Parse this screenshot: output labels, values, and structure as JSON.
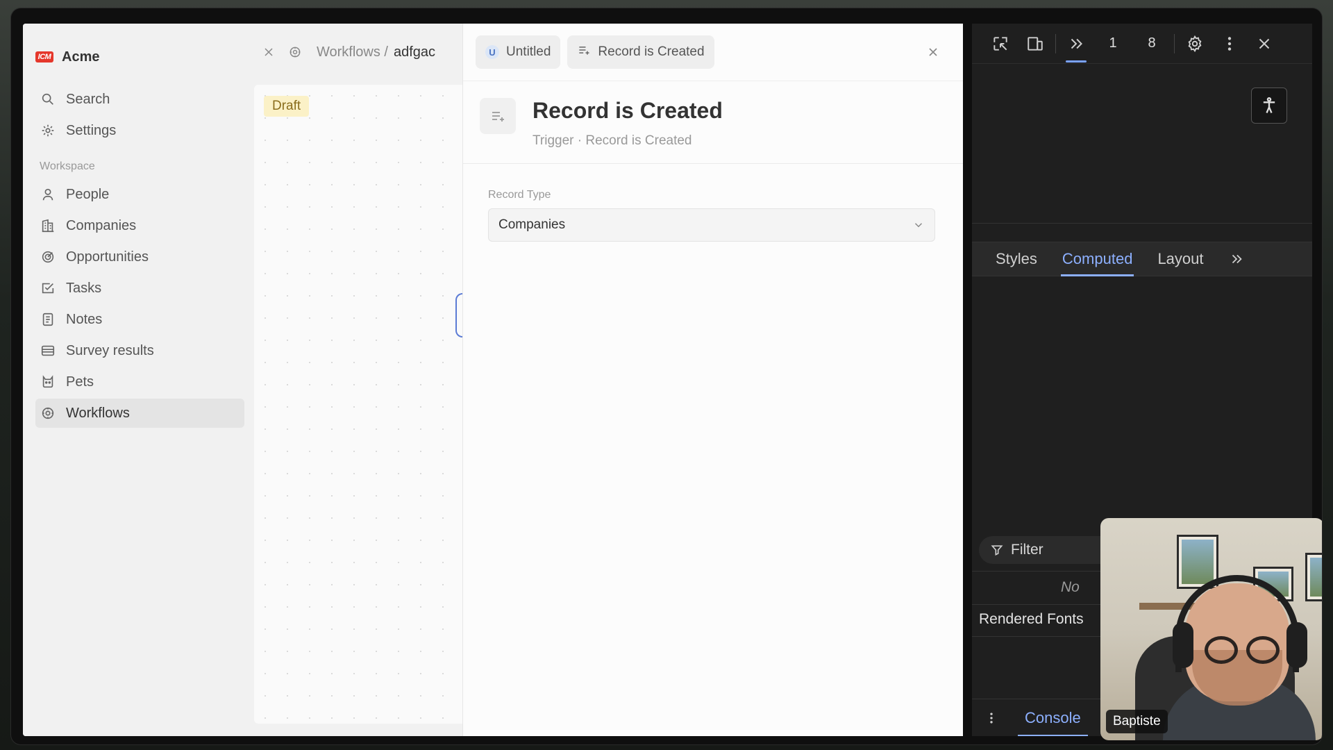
{
  "app": {
    "brand_logo_text": "ICM",
    "brand_name": "Acme",
    "nav_top": [
      {
        "label": "Search",
        "icon": "search-icon"
      },
      {
        "label": "Settings",
        "icon": "gear-icon"
      }
    ],
    "workspace_label": "Workspace",
    "nav_workspace": [
      {
        "label": "People",
        "icon": "person-icon"
      },
      {
        "label": "Companies",
        "icon": "building-icon"
      },
      {
        "label": "Opportunities",
        "icon": "target-icon"
      },
      {
        "label": "Tasks",
        "icon": "checkbox-icon"
      },
      {
        "label": "Notes",
        "icon": "note-icon"
      },
      {
        "label": "Survey results",
        "icon": "table-icon"
      },
      {
        "label": "Pets",
        "icon": "cat-icon"
      },
      {
        "label": "Workflows",
        "icon": "workflow-gear-icon",
        "active": true
      }
    ]
  },
  "breadcrumb": {
    "parent": "Workflows /",
    "current": "adfgac"
  },
  "canvas": {
    "status_badge": "Draft"
  },
  "panel": {
    "tabs": [
      {
        "badge": "U",
        "label": "Untitled"
      },
      {
        "icon": "playlist-add-icon",
        "label": "Record is Created"
      }
    ],
    "title": "Record is Created",
    "subtitle": "Trigger · Record is Created",
    "field_label": "Record Type",
    "field_value": "Companies"
  },
  "devtools": {
    "count_a": "1",
    "count_b": "8",
    "tabs": [
      "Styles",
      "Computed",
      "Layout"
    ],
    "active_tab": "Computed",
    "filter_label": "Filter",
    "no_props_text": "No",
    "rendered_fonts_label": "Rendered Fonts",
    "console_tab": "Console"
  },
  "webcam": {
    "name": "Baptiste"
  },
  "colors": {
    "accent_blue": "#8db0ff",
    "brand_red": "#e5372b",
    "draft_bg": "#fbf1c7"
  }
}
